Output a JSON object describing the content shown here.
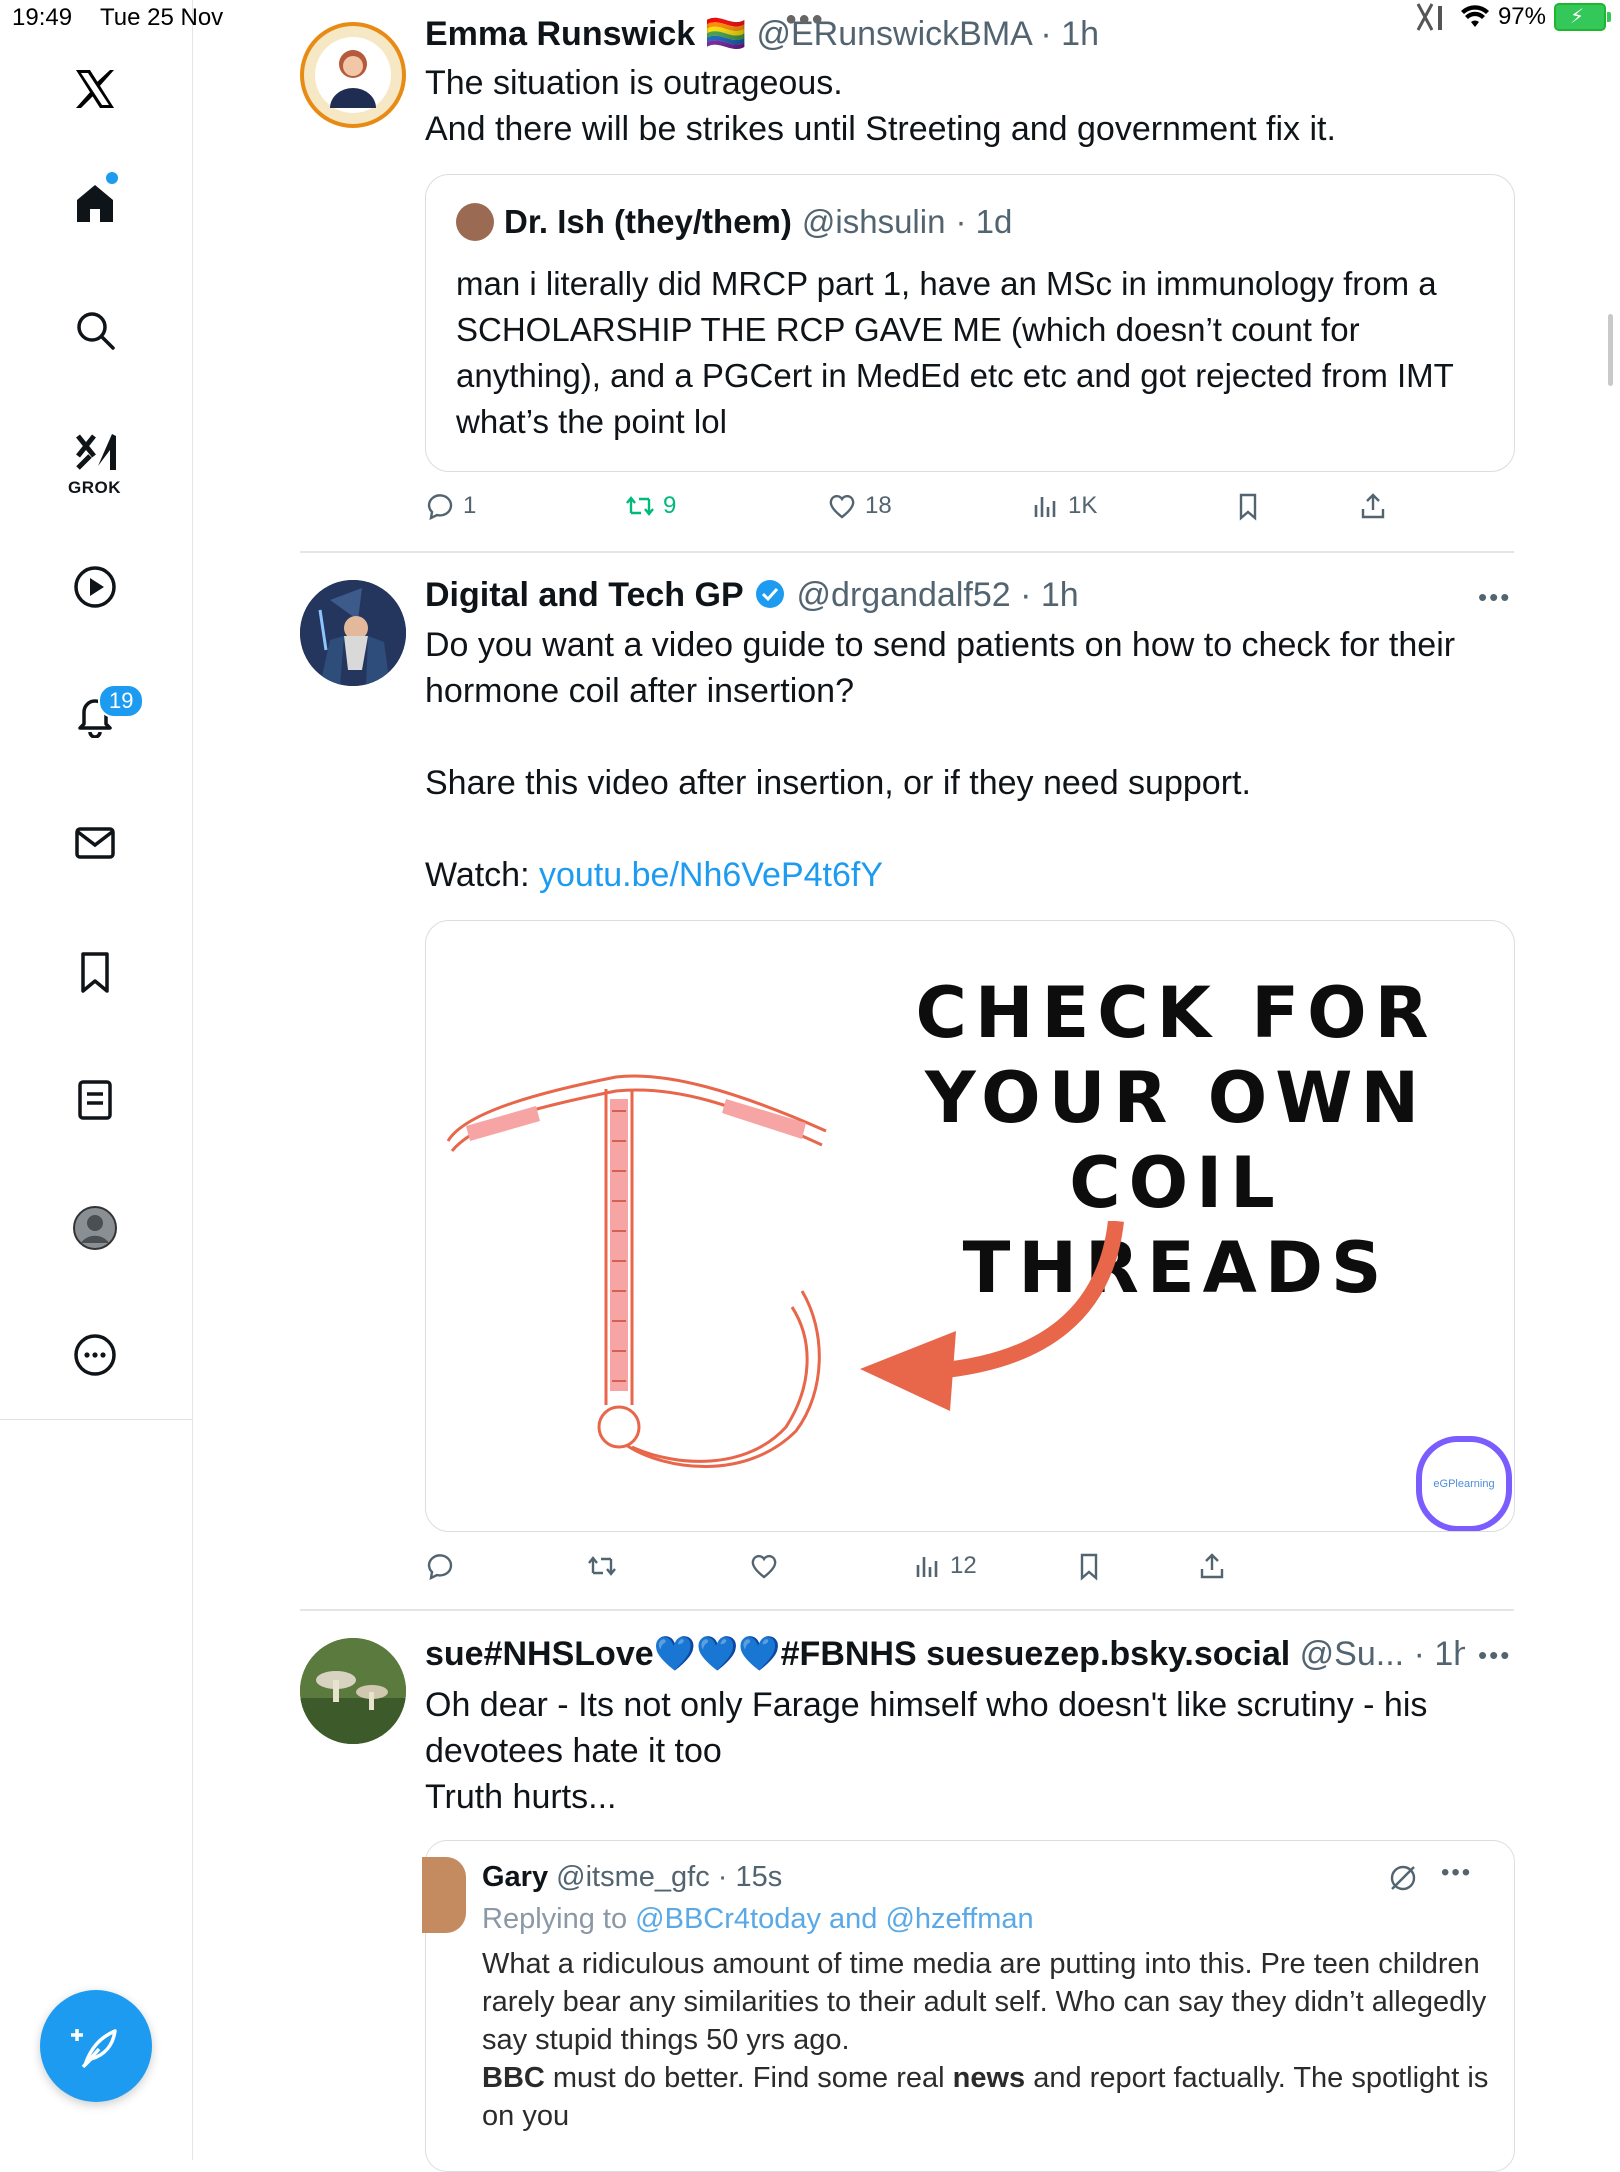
{
  "status_bar": {
    "time": "19:49",
    "date": "Tue 25 Nov",
    "battery": "97%"
  },
  "sidebar": {
    "grok_label": "GROK",
    "notifications_badge": "19"
  },
  "tweets": [
    {
      "name": "Emma Runswick",
      "flag": "🏳️‍🌈",
      "handle": "@ERunswickBMA",
      "time": "· 1h",
      "lines": [
        "The situation is outrageous.",
        "And there will be strikes until Streeting and government fix it."
      ],
      "quote": {
        "name": "Dr. Ish (they/them)",
        "handle": "@ishsulin",
        "time": "· 1d",
        "text": "man i literally did MRCP part 1, have an MSc in immunology from a SCHOLARSHIP THE RCP GAVE ME (which doesn’t count for anything), and a PGCert in MedEd etc etc and got rejected from IMT what’s the point lol"
      },
      "actions": {
        "replies": "1",
        "reposts": "9",
        "likes": "18",
        "views": "1K"
      }
    },
    {
      "name": "Digital and Tech GP",
      "handle": "@drgandalf52",
      "time": "· 1h",
      "line1": "Do you want a video guide to send patients on how to check for their hormone coil after insertion?",
      "line2": "Share this video after insertion, or if they need support.",
      "watch_label": "Watch: ",
      "watch_link": "youtu.be/Nh6VeP4t6fY",
      "media_title": "CHECK FOR YOUR OWN COIL THREADS",
      "media_logo": "eGPlearning",
      "actions": {
        "views": "12"
      }
    },
    {
      "name": "sue#NHSLove💙💙💙#FBNHS suesuezep.bsky.social",
      "handle": "@Su...",
      "time": "· 1h",
      "lines": [
        "Oh dear - Its not only Farage himself who doesn't like scrutiny - his",
        "devotees hate it too",
        "Truth hurts..."
      ],
      "inner": {
        "name": "Gary",
        "handle": "@itsme_gfc · 15s",
        "replying": "Replying to ",
        "reply_to": "@BBCr4today and @hzeffman",
        "text1": "What a ridiculous amount of time media are putting into this. Pre teen children rarely bear any similarities to their adult self. Who can say they didn’t allegedly say stupid things 50 yrs ago.",
        "text2_a": "BBC",
        "text2_b": " must do better. Find some real ",
        "text2_c": "news",
        "text2_d": " and report factually. The spotlight is on you"
      }
    }
  ],
  "colors": {
    "accent": "#1d9bf0",
    "repost_green": "#00ba7c",
    "coil_orange": "#e8664a"
  }
}
